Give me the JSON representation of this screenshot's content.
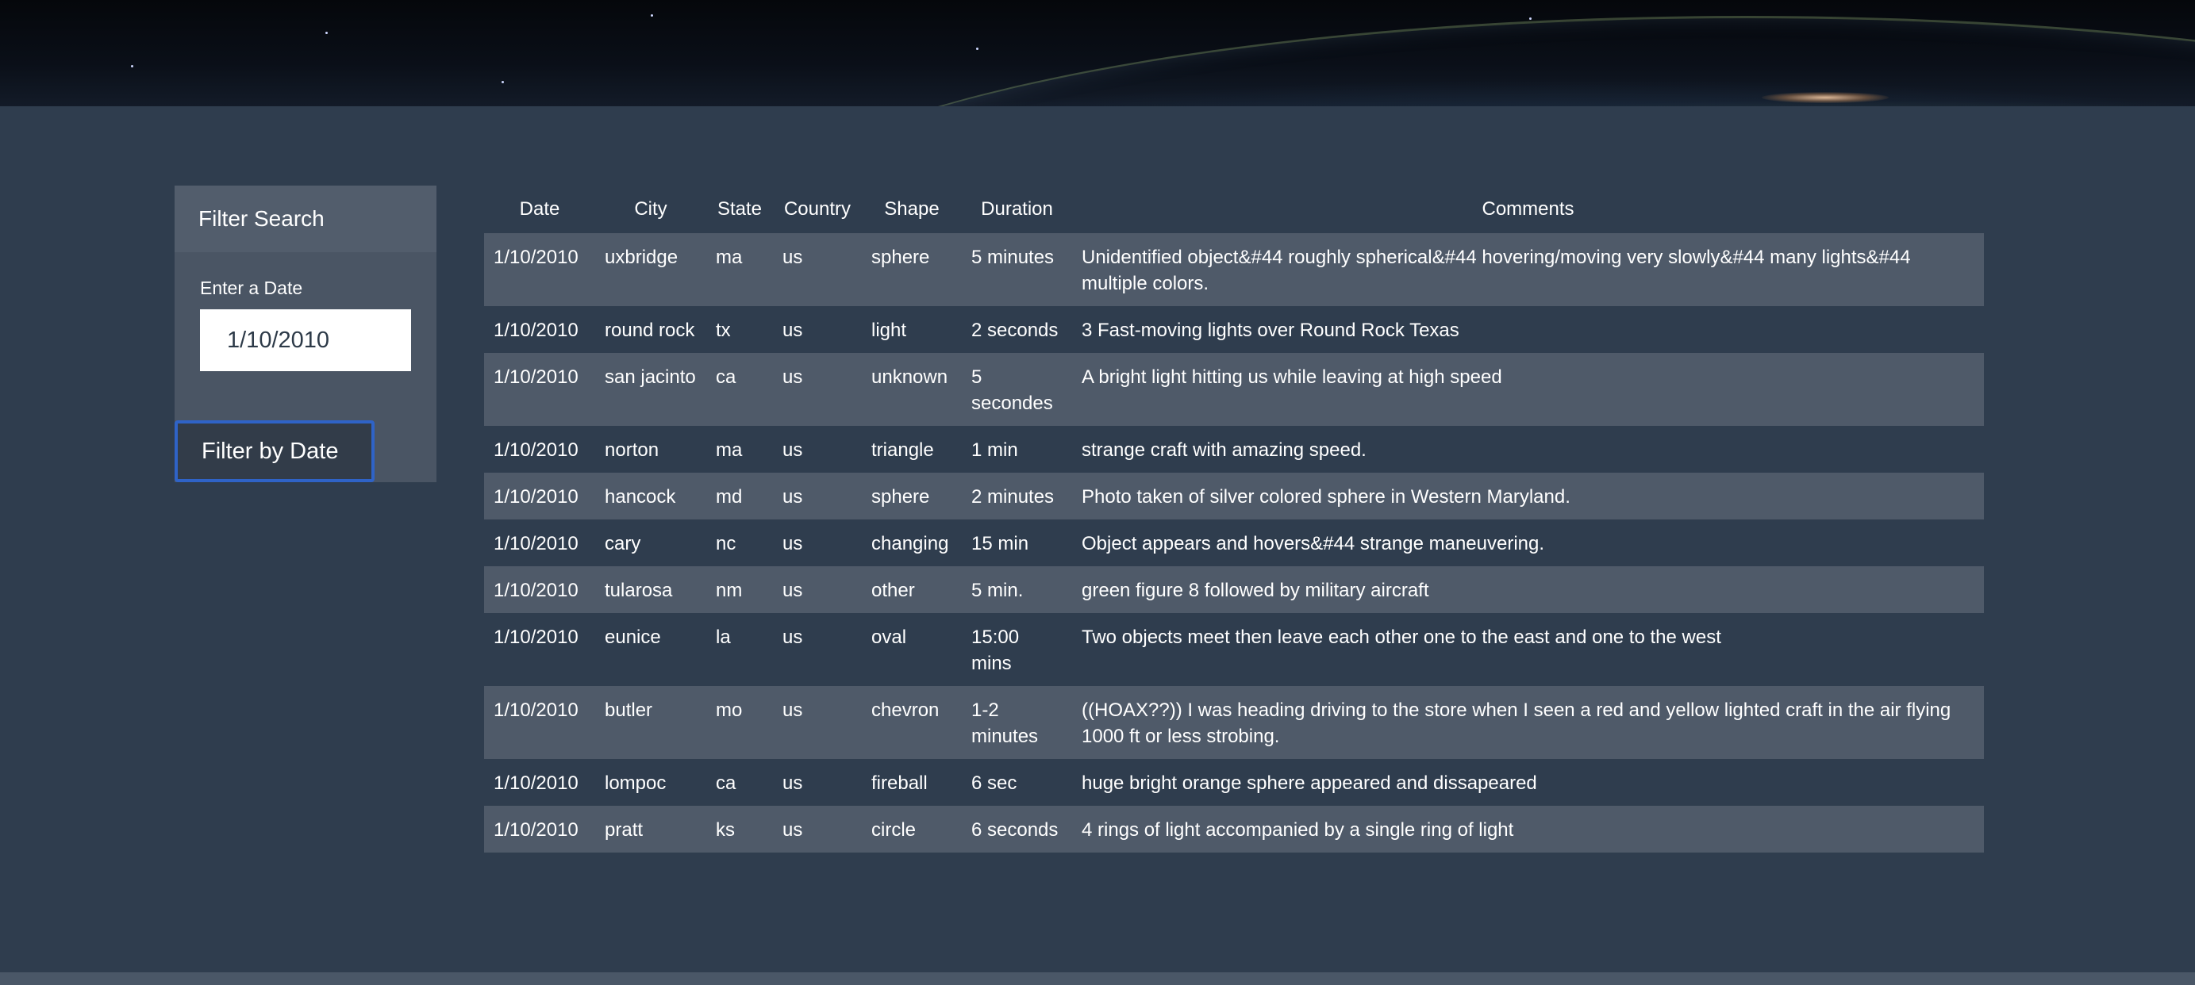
{
  "filter": {
    "title": "Filter Search",
    "date_label": "Enter a Date",
    "date_value": "1/10/2010",
    "button_label": "Filter by Date"
  },
  "table": {
    "headers": {
      "date": "Date",
      "city": "City",
      "state": "State",
      "country": "Country",
      "shape": "Shape",
      "duration": "Duration",
      "comments": "Comments"
    },
    "rows": [
      {
        "date": "1/10/2010",
        "city": "uxbridge",
        "state": "ma",
        "country": "us",
        "shape": "sphere",
        "duration": "5 minutes",
        "comments": "Unidentified object&#44 roughly spherical&#44 hovering/moving very slowly&#44 many lights&#44 multiple colors."
      },
      {
        "date": "1/10/2010",
        "city": "round rock",
        "state": "tx",
        "country": "us",
        "shape": "light",
        "duration": "2 seconds",
        "comments": "3 Fast-moving lights over Round Rock Texas"
      },
      {
        "date": "1/10/2010",
        "city": "san jacinto",
        "state": "ca",
        "country": "us",
        "shape": "unknown",
        "duration": "5 secondes",
        "comments": "A bright light hitting us while leaving at high speed"
      },
      {
        "date": "1/10/2010",
        "city": "norton",
        "state": "ma",
        "country": "us",
        "shape": "triangle",
        "duration": "1 min",
        "comments": "strange craft with amazing speed."
      },
      {
        "date": "1/10/2010",
        "city": "hancock",
        "state": "md",
        "country": "us",
        "shape": "sphere",
        "duration": "2 minutes",
        "comments": "Photo taken of silver colored sphere in Western Maryland."
      },
      {
        "date": "1/10/2010",
        "city": "cary",
        "state": "nc",
        "country": "us",
        "shape": "changing",
        "duration": "15 min",
        "comments": "Object appears and hovers&#44 strange maneuvering."
      },
      {
        "date": "1/10/2010",
        "city": "tularosa",
        "state": "nm",
        "country": "us",
        "shape": "other",
        "duration": "5 min.",
        "comments": "green figure 8 followed by military aircraft"
      },
      {
        "date": "1/10/2010",
        "city": "eunice",
        "state": "la",
        "country": "us",
        "shape": "oval",
        "duration": "15:00 mins",
        "comments": "Two objects meet then leave each other one to the east and one to the west"
      },
      {
        "date": "1/10/2010",
        "city": "butler",
        "state": "mo",
        "country": "us",
        "shape": "chevron",
        "duration": "1-2 minutes",
        "comments": "((HOAX??)) I was heading driving to the store when I seen a red and yellow lighted craft in the air flying 1000 ft or less strobing."
      },
      {
        "date": "1/10/2010",
        "city": "lompoc",
        "state": "ca",
        "country": "us",
        "shape": "fireball",
        "duration": "6 sec",
        "comments": "huge bright orange sphere appeared and dissapeared"
      },
      {
        "date": "1/10/2010",
        "city": "pratt",
        "state": "ks",
        "country": "us",
        "shape": "circle",
        "duration": "6 seconds",
        "comments": "4 rings of light accompanied by a single ring of light"
      }
    ]
  }
}
